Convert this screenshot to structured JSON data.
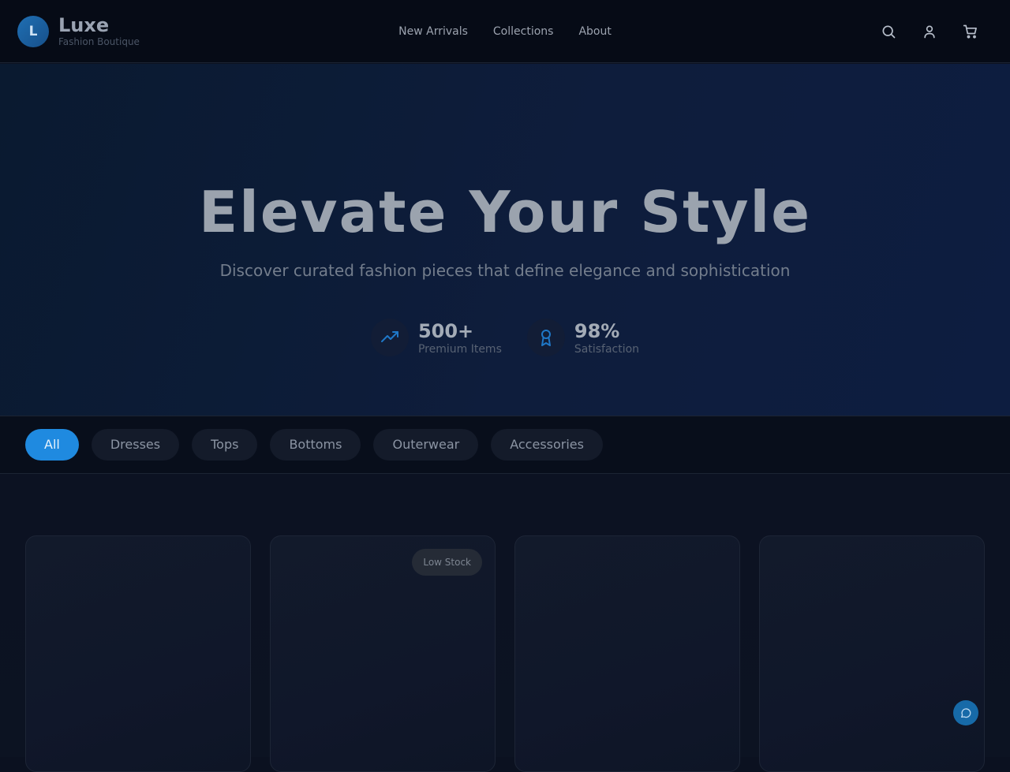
{
  "header": {
    "logo_letter": "L",
    "brand_name": "Luxe",
    "brand_tagline": "Fashion Boutique",
    "nav": [
      "New Arrivals",
      "Collections",
      "About"
    ],
    "icons": [
      "search-icon",
      "user-icon",
      "cart-icon"
    ]
  },
  "hero": {
    "title": "Elevate Your Style",
    "subtitle": "Discover curated fashion pieces that define elegance and sophistication",
    "stats": [
      {
        "icon": "trending-up-icon",
        "value": "500+",
        "label": "Premium Items"
      },
      {
        "icon": "award-icon",
        "value": "98%",
        "label": "Satisfaction"
      }
    ]
  },
  "filters": {
    "active": "All",
    "items": [
      "All",
      "Dresses",
      "Tops",
      "Bottoms",
      "Outerwear",
      "Accessories"
    ]
  },
  "products": {
    "cards": [
      {
        "badge": ""
      },
      {
        "badge": "Low Stock"
      },
      {
        "badge": ""
      },
      {
        "badge": ""
      }
    ]
  },
  "colors": {
    "accent": "#1f8ae0",
    "background": "#0b1120",
    "header_bg": "#060b16",
    "hero_bg": "#0e1d3c"
  },
  "chat": {
    "icon": "chat-bubble-icon"
  }
}
